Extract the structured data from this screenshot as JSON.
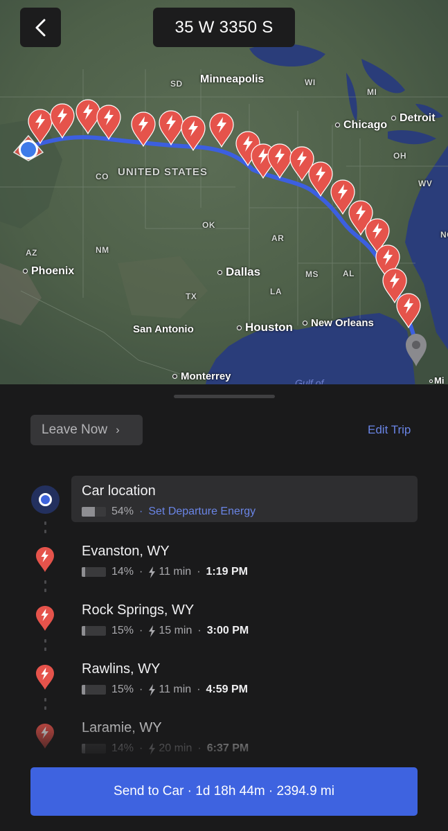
{
  "header": {
    "back_icon": "chevron-left-icon",
    "address": "35 W 3350 S"
  },
  "map": {
    "cities": {
      "minneapolis": "Minneapolis",
      "chicago": "Chicago",
      "detroit": "Detroit",
      "phoenix": "Phoenix",
      "dallas": "Dallas",
      "houston": "Houston",
      "new_orleans": "New Orleans",
      "san_antonio": "San Antonio",
      "monterrey": "Monterrey",
      "mi_partial": "Mi"
    },
    "states": {
      "sd": "SD",
      "wi": "WI",
      "mi": "MI",
      "co": "CO",
      "oh": "OH",
      "wv": "WV",
      "ok": "OK",
      "ar": "AR",
      "az": "AZ",
      "nm": "NM",
      "tx": "TX",
      "ms": "MS",
      "al": "AL",
      "la": "LA",
      "nc": "NC"
    },
    "country": "UNITED STATES",
    "gulf": "Gulf of",
    "supercharger_count": 22,
    "colors": {
      "route": "#3c5fe0",
      "charger_pin": "#e5534b",
      "destination_pin": "#8a8a8e"
    }
  },
  "sheet": {
    "leave_now": "Leave Now",
    "leave_now_chevron": "›",
    "edit_trip": "Edit Trip",
    "stops": [
      {
        "name": "Car location",
        "battery": "54%",
        "battery_level": 0.54,
        "action": "Set Departure Energy",
        "sep": "·"
      },
      {
        "name": "Evanston, WY",
        "battery": "14%",
        "battery_level": 0.14,
        "charge_time": "11 min",
        "arrival": "1:19 PM",
        "sep": "·"
      },
      {
        "name": "Rock Springs, WY",
        "battery": "15%",
        "battery_level": 0.15,
        "charge_time": "15 min",
        "arrival": "3:00 PM",
        "sep": "·"
      },
      {
        "name": "Rawlins, WY",
        "battery": "15%",
        "battery_level": 0.15,
        "charge_time": "11 min",
        "arrival": "4:59 PM",
        "sep": "·"
      },
      {
        "name": "Laramie, WY",
        "battery": "14%",
        "battery_level": 0.14,
        "charge_time": "20 min",
        "arrival": "6:37 PM",
        "sep": "·"
      }
    ],
    "send_button": "Send to Car · 1d 18h 44m · 2394.9 mi"
  },
  "colors": {
    "accent": "#3e63e0",
    "link": "#6a85e6",
    "background": "#1a1a1b",
    "charger": "#e5534b"
  }
}
